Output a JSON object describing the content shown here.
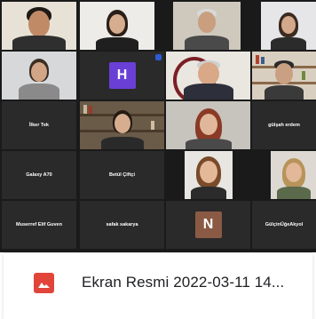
{
  "participants": {
    "r2": {
      "h_initial": "H"
    },
    "r3": {
      "c1": "İlker Tek",
      "c5": "gülşah erdem"
    },
    "r4": {
      "c1": "Galaxy A70",
      "c2": "Betül Çiftçi"
    },
    "r5": {
      "c1": "Muserref Elif Guven",
      "c2": "safak sakarya",
      "n_initial": "N",
      "c5": "GülçinÜğeAkyol"
    }
  },
  "colors": {
    "h_avatar": "#6a3fd6",
    "n_avatar": "#8a5a44",
    "file_icon": "#e1453a"
  },
  "attachment": {
    "icon": "image-file-icon",
    "file_name": "Ekran Resmi 2022-03-11 14..."
  }
}
